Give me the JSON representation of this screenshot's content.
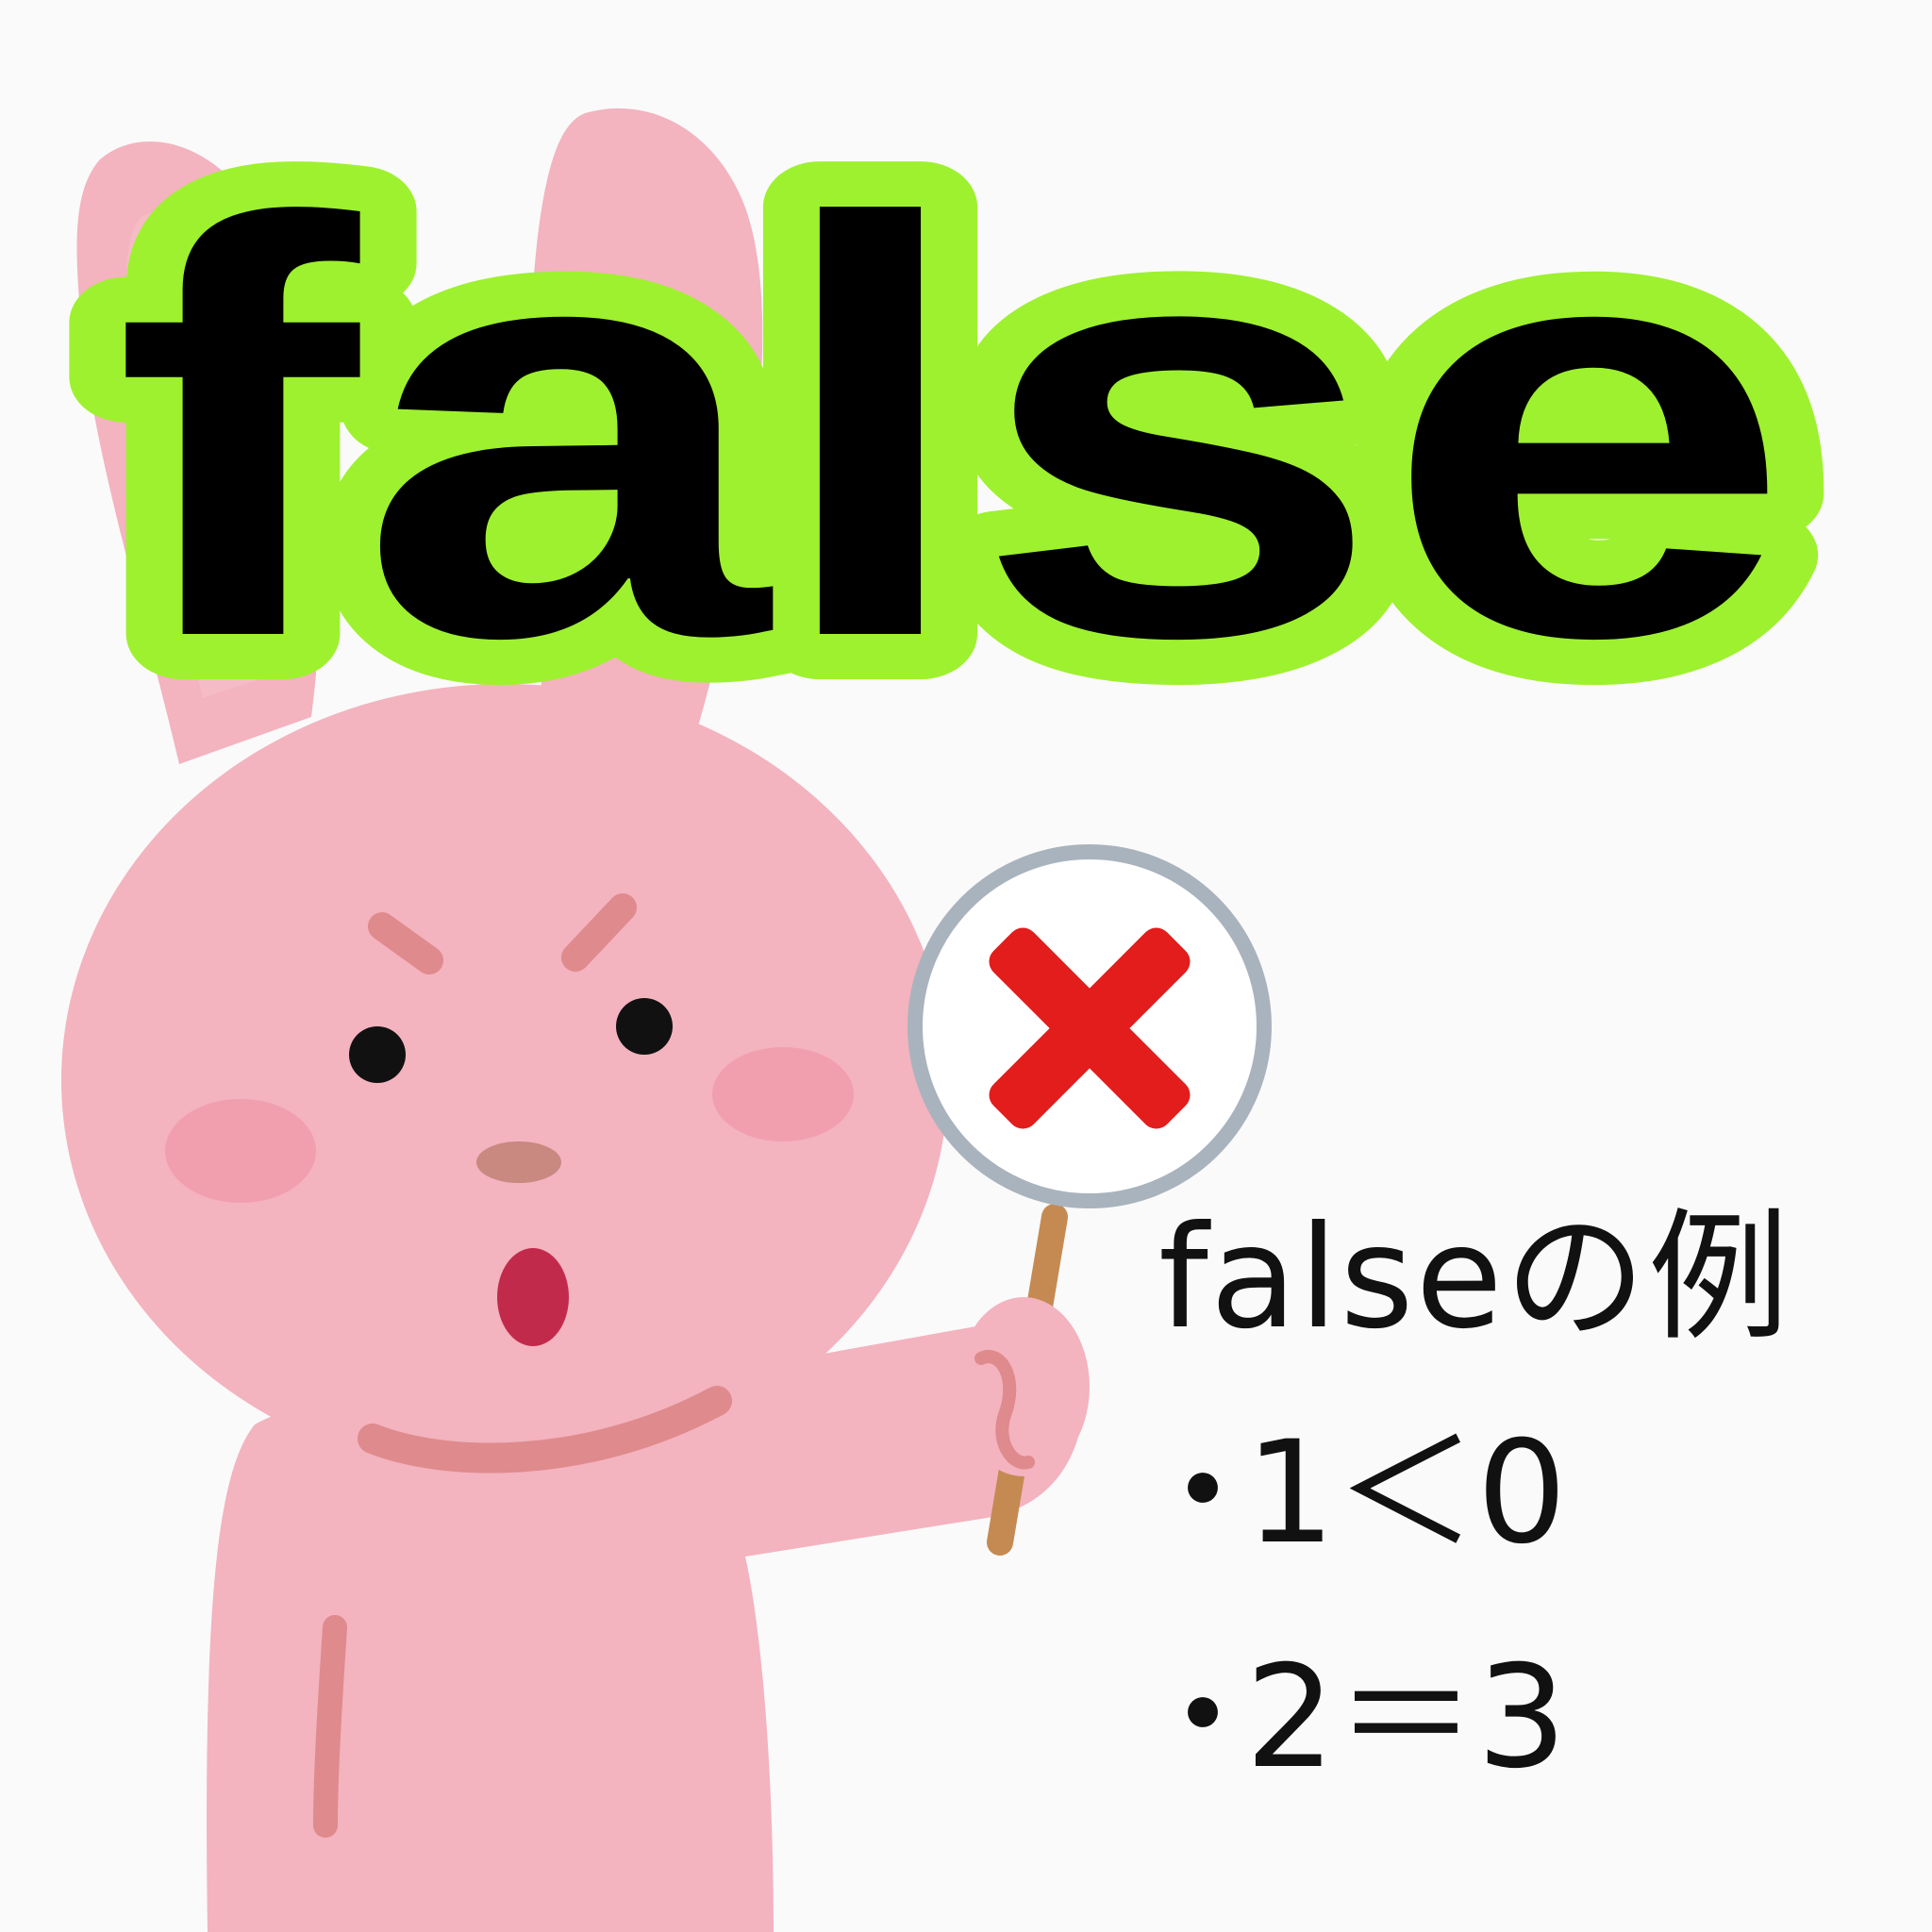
{
  "headline": {
    "text": "false",
    "fill": "#000000",
    "outline": "#9ef12e"
  },
  "examples": {
    "title": "falseの例",
    "items": [
      {
        "bullet": "・",
        "text": "1＜0"
      },
      {
        "bullet": "・",
        "text": "2＝3"
      }
    ]
  },
  "sign": {
    "mark": "✕",
    "mark_color": "#e31c1c",
    "rim_color": "#a9b3bd"
  },
  "colors": {
    "background": "#fafafa",
    "rabbit_pink": "#f3b3bf",
    "stick_brown": "#c58a52"
  }
}
